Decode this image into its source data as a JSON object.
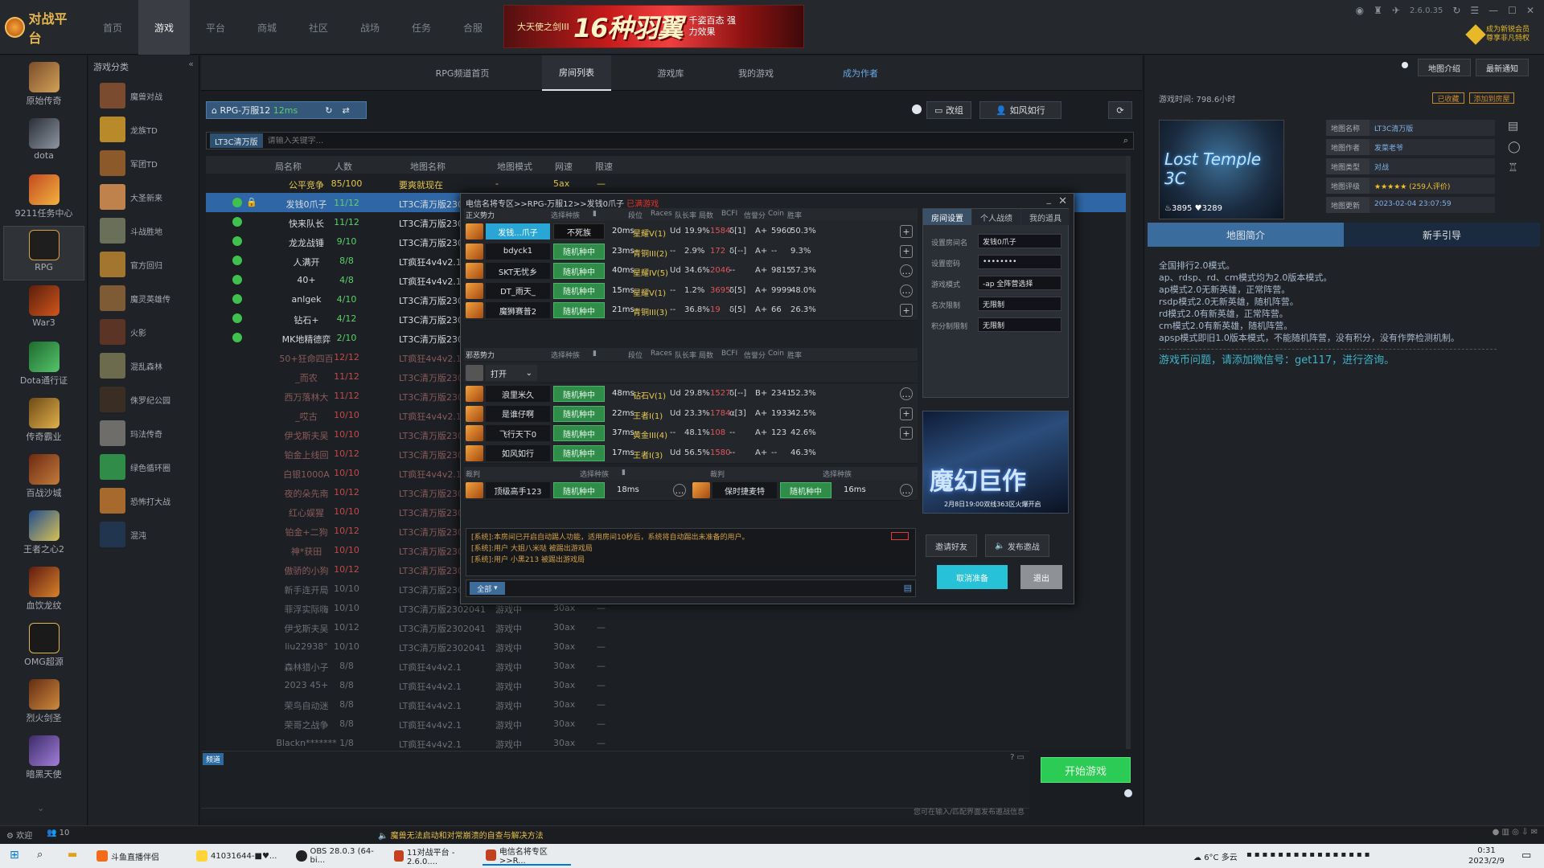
{
  "app": {
    "logo": "对战平台",
    "version": "2.6.0.35",
    "vip_text": "成为新锐会员 尊享非凡特权"
  },
  "topnav": [
    "首页",
    "游戏",
    "平台",
    "商城",
    "社区",
    "战场",
    "任务",
    "合服"
  ],
  "banner": {
    "small": "大天使之剑III",
    "big": "16种羽翼",
    "sub": "千姿百态 强力效果"
  },
  "left_games": [
    "原始传奇",
    "dota",
    "9211任务中心",
    "RPG",
    "War3",
    "Dota通行证",
    "传奇霸业",
    "百战沙城",
    "王者之心2",
    "血饮龙纹",
    "OMG超源",
    "烈火剑圣",
    "暗黑天使"
  ],
  "category": {
    "title": "游戏分类",
    "items": [
      "魔兽对战",
      "龙族TD",
      "军团TD",
      "大圣新来",
      "斗战胜地",
      "官方回归",
      "魔灵英雄传",
      "火影",
      "混乱森林",
      "侏罗纪公园",
      "玛法传奇",
      "绿色循环圈",
      "恐怖打大战",
      "混沌"
    ]
  },
  "tabs": [
    "RPG频道首页",
    "房间列表",
    "游戏库",
    "我的游戏",
    "成为作者"
  ],
  "room": {
    "name": "RPG-万服12",
    "ping": "12ms",
    "btn_edit": "改组",
    "btn_invite": "如风如行",
    "search_tag": "LT3C清万版",
    "search_placeholder": "请输入关键字..."
  },
  "list_headers": [
    "局名称",
    "人数",
    "地图名称",
    "地图模式",
    "网速",
    "限速"
  ],
  "rooms": [
    {
      "name": "公平竞争",
      "count": "85/100",
      "map": "要爽就现在",
      "mode": "-",
      "speed": "5ax",
      "limit": "—",
      "style": "top"
    },
    {
      "name": "发钱0爪子",
      "count": "11/12",
      "map": "LT3C清万版2302041",
      "mode": "",
      "speed": "",
      "limit": "",
      "style": "sel"
    },
    {
      "name": "快来队长",
      "count": "11/12",
      "map": "LT3C清万版2302041",
      "style": "g"
    },
    {
      "name": "龙龙战锤",
      "count": "9/10",
      "map": "LT3C清万版2302041",
      "style": "g"
    },
    {
      "name": "人满开",
      "count": "8/8",
      "map": "LT疯狂4v4v2.1",
      "style": "g"
    },
    {
      "name": "40+",
      "count": "4/8",
      "map": "LT疯狂4v4v2.1",
      "style": "g"
    },
    {
      "name": "anlgek",
      "count": "4/10",
      "map": "LT3C清万版2302041",
      "style": "g"
    },
    {
      "name": "钻石+",
      "count": "4/12",
      "map": "LT3C清万版2302041",
      "style": "g"
    },
    {
      "name": "MK地精德弈",
      "count": "2/10",
      "map": "LT3C清万版2302041",
      "style": "g"
    },
    {
      "name": "50+狂命四百",
      "count": "12/12",
      "map": "LT疯狂4v4v2.1",
      "style": "dim"
    },
    {
      "name": "_而农",
      "count": "11/12",
      "map": "LT3C清万版2302041",
      "style": "dim"
    },
    {
      "name": "西万落林大",
      "count": "11/12",
      "map": "LT3C清万版2302041",
      "style": "dim"
    },
    {
      "name": "_哎古",
      "count": "10/10",
      "map": "LT疯狂4v4v2.1",
      "style": "dim"
    },
    {
      "name": "伊戈斯夫吴",
      "count": "10/10",
      "map": "LT3C清万版2302041",
      "style": "dim"
    },
    {
      "name": "铂金上线回",
      "count": "10/12",
      "map": "LT3C清万版2302041",
      "style": "dim"
    },
    {
      "name": "白银1000A",
      "count": "10/10",
      "map": "LT疯狂4v4v2.1",
      "style": "dim"
    },
    {
      "name": "夜的朵先南",
      "count": "10/12",
      "map": "LT3C清万版2302041",
      "style": "dim"
    },
    {
      "name": "红心娱猩",
      "count": "10/10",
      "map": "LT3C清万版2302041",
      "style": "dim"
    },
    {
      "name": "铂金+二狗",
      "count": "10/12",
      "map": "LT3C清万版2302041",
      "style": "dim"
    },
    {
      "name": "神*获田",
      "count": "10/10",
      "map": "LT3C清万版2302041",
      "style": "dim"
    },
    {
      "name": "傲骄的小狗",
      "count": "10/12",
      "map": "LT3C清万版2302041",
      "style": "dim"
    },
    {
      "name": "新手连开局",
      "count": "10/10",
      "map": "LT3C清万版2302041",
      "style": "dim"
    },
    {
      "name": "菲浮实际嗨",
      "count": "10/10",
      "map": "LT3C清万版2302041",
      "mode": "游戏中",
      "speed": "30ax",
      "limit": "—",
      "style": "dim"
    },
    {
      "name": "伊戈斯夫吴",
      "count": "10/12",
      "map": "LT3C清万版2302041",
      "mode": "游戏中",
      "speed": "30ax",
      "limit": "—",
      "style": "dim"
    },
    {
      "name": "liu22938°",
      "count": "10/10",
      "map": "LT3C清万版2302041",
      "mode": "游戏中",
      "speed": "30ax",
      "limit": "—",
      "style": "dim"
    },
    {
      "name": "森林猎小子",
      "count": "8/8",
      "map": "LT疯狂4v4v2.1",
      "mode": "游戏中",
      "speed": "30ax",
      "limit": "—",
      "style": "dim"
    },
    {
      "name": "2023 45+",
      "count": "8/8",
      "map": "LT疯狂4v4v2.1",
      "mode": "游戏中",
      "speed": "30ax",
      "limit": "—",
      "style": "dim"
    },
    {
      "name": "荣鸟自动迷",
      "count": "8/8",
      "map": "LT疯狂4v4v2.1",
      "mode": "游戏中",
      "speed": "30ax",
      "limit": "—",
      "style": "dim"
    },
    {
      "name": "荣哥之战争",
      "count": "8/8",
      "map": "LT疯狂4v4v2.1",
      "mode": "游戏中",
      "speed": "30ax",
      "limit": "—",
      "style": "dim"
    },
    {
      "name": "Blackn*******",
      "count": "1/8",
      "map": "LT疯狂4v4v2.1",
      "mode": "游戏中",
      "speed": "30ax",
      "limit": "—",
      "style": "dim"
    }
  ],
  "dialog": {
    "title": "电信名将专区>>RPG-万服12>>发钱0爪子",
    "title_red": "已满游戏",
    "team1": "正义势力",
    "team2": "邪恶势力",
    "ref": "裁判",
    "col_headers": [
      "选择种族",
      "段位",
      "Races",
      "队长率",
      "局数",
      "BCFI",
      "信誉分",
      "Coin",
      "胜率"
    ],
    "players_a": [
      {
        "name": "发钱...爪子",
        "status": "不死族",
        "ping": "20ms",
        "rank": "星耀V(1)",
        "race": "Ud",
        "rate": "19.9%",
        "games": "1584",
        "bcfi": "δ[1]",
        "credit": "A+",
        "coin": "5960",
        "win": "50.3%",
        "hl": true,
        "act": "+"
      },
      {
        "name": "bdyck1",
        "status": "随机种中",
        "ping": "23ms",
        "rank": "青铜III(2)",
        "race": "--",
        "rate": "2.9%",
        "games": "172",
        "bcfi": "δ[--]",
        "credit": "A+",
        "coin": "--",
        "win": "9.3%",
        "act": "+"
      },
      {
        "name": "SKT无忧乡",
        "status": "随机种中",
        "ping": "40ms",
        "rank": "星耀IV(5)",
        "race": "Ud",
        "rate": "34.6%",
        "games": "2046",
        "bcfi": "--",
        "credit": "A+",
        "coin": "9815",
        "win": "57.3%",
        "act": "…"
      },
      {
        "name": "DT_雨天_",
        "status": "随机种中",
        "ping": "15ms",
        "rank": "星耀V(1)",
        "race": "--",
        "rate": "1.2%",
        "games": "3695",
        "bcfi": "δ[5]",
        "credit": "A+",
        "coin": "9999",
        "win": "48.0%",
        "act": "…"
      },
      {
        "name": "魔狮赛普2",
        "status": "随机种中",
        "ping": "21ms",
        "rank": "青铜III(3)",
        "race": "--",
        "rate": "36.8%",
        "games": "19",
        "bcfi": "δ[5]",
        "credit": "A+",
        "coin": "66",
        "win": "26.3%",
        "act": "+"
      }
    ],
    "team2_dropdown": "打开",
    "players_b": [
      {
        "name": "浪里米久",
        "status": "随机种中",
        "ping": "48ms",
        "rank": "钻石V(1)",
        "race": "Ud",
        "rate": "29.8%",
        "games": "1527",
        "bcfi": "δ[--]",
        "credit": "B+",
        "coin": "2341",
        "win": "52.3%",
        "act": "…"
      },
      {
        "name": "是谁仔啊",
        "status": "随机种中",
        "ping": "22ms",
        "rank": "王者I(1)",
        "race": "Ud",
        "rate": "23.3%",
        "games": "1784",
        "bcfi": "α[3]",
        "credit": "A+",
        "coin": "1933",
        "win": "42.5%",
        "act": "+"
      },
      {
        "name": "飞行天下0",
        "status": "随机种中",
        "ping": "37ms",
        "rank": "黄金III(4)",
        "race": "--",
        "rate": "48.1%",
        "games": "108",
        "bcfi": "--",
        "credit": "A+",
        "coin": "123",
        "win": "42.6%",
        "act": "+"
      },
      {
        "name": "如风如行",
        "status": "随机种中",
        "ping": "17ms",
        "rank": "王者I(3)",
        "race": "Ud",
        "rate": "56.5%",
        "games": "1580",
        "bcfi": "--",
        "credit": "A+",
        "coin": "--",
        "win": "46.3%",
        "act": ""
      }
    ],
    "refs": [
      {
        "name": "顶级高手123",
        "status": "随机种中",
        "ping": "18ms"
      },
      {
        "name": "保时捷麦特",
        "status": "随机种中",
        "ping": "16ms"
      }
    ],
    "right_tabs": [
      "房间设置",
      "个人战绩",
      "我的道具"
    ],
    "fields": [
      {
        "label": "设置房间名",
        "value": "发钱0爪子"
      },
      {
        "label": "设置密码",
        "value": "••••••••"
      },
      {
        "label": "游戏模式",
        "value": "-ap 全阵营选择"
      },
      {
        "label": "名次限制",
        "value": "无限制"
      },
      {
        "label": "积分制限制",
        "value": "无限制"
      }
    ],
    "promo_title": "魔幻巨作",
    "promo_sub": "2月8日19:00双线363区火爆开启",
    "chat": [
      "[系统]:本房间已开启自动踢人功能，适用房间10秒后，系统将自动踢出未准备的用户。",
      "[系统]:用户 大姐八米哒 被踢出游戏局",
      "[系统]:用户 小黑213 被踢出游戏局"
    ],
    "chat_btn": "全部",
    "btn_invite": "邀请好友",
    "btn_broadcast": "发布邀战",
    "btn_cancel": "取消准备",
    "btn_leave": "退出"
  },
  "right": {
    "game_time": "游戏时间: 798.6小时",
    "tag1": "已收藏",
    "tag2": "添加到房屋",
    "map_title": "Lost Temple 3C",
    "stars_count": "3895",
    "hearts": "3289",
    "info": [
      {
        "k": "地图名称",
        "v": "LT3C清万版"
      },
      {
        "k": "地图作者",
        "v": "发菜老爷"
      },
      {
        "k": "地图类型",
        "v": "对战"
      },
      {
        "k": "地图评级",
        "v": "★★★★★ (259人评价)"
      },
      {
        "k": "地图更新",
        "v": "2023-02-04 23:07:59"
      }
    ],
    "tab_intro": "地图简介",
    "tab_guide": "新手引导",
    "desc": [
      "全国排行2.0模式。",
      "ap、rdsp、rd、cm模式均为2.0版本模式。",
      "ap模式2.0无新英雄，正常阵营。",
      "rsdp模式2.0无新英雄，随机阵营。",
      "rd模式2.0有新英雄，正常阵营。",
      "cm模式2.0有新英雄，随机阵营。",
      "apsp模式即旧1.0版本模式，不能随机阵营，没有积分，没有作弊检测机制。"
    ],
    "contact": "游戏币问题，请添加微信号：get117，进行咨询。"
  },
  "header_top": {
    "btn1": "地图介绍",
    "btn2": "最新通知",
    "btn_author": "成为作者"
  },
  "start_btn": "开始游戏",
  "bottom": {
    "chat_tag": "频道",
    "hint": "您可在输入/匹配界面发布邀战信息"
  },
  "status": {
    "user": "欢迎",
    "count": "10",
    "notice": "魔兽无法启动和对常崩溃的自查与解决方法"
  },
  "taskbar": {
    "items": [
      "斗鱼直播伴侣",
      "41031644-■♥...",
      "OBS 28.0.3 (64-bi...",
      "11对战平台 - 2.6.0....",
      "电信名将专区>>R..."
    ],
    "weather": "6°C 多云",
    "time": "0:31",
    "date": "2023/2/9"
  }
}
